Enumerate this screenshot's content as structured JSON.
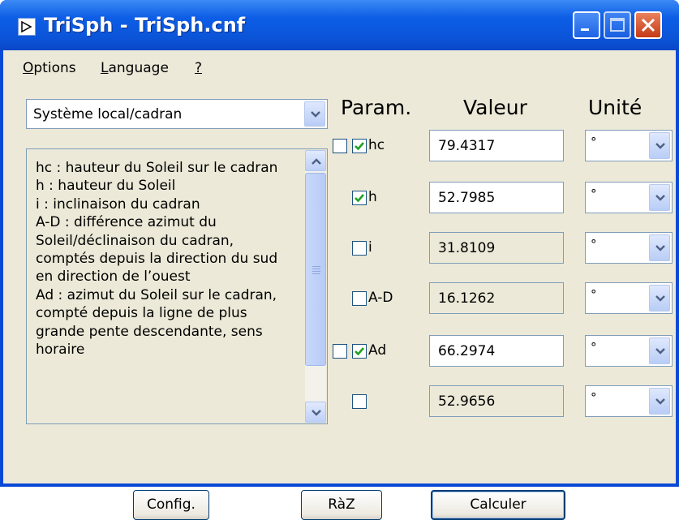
{
  "window": {
    "title": "TriSph - TriSph.cnf",
    "accent_color": "#0a49d6",
    "controls": [
      "minimize-icon",
      "maximize-icon",
      "close-icon"
    ]
  },
  "menu": {
    "items": [
      {
        "label": "Options",
        "accel": "O",
        "rest": "ptions"
      },
      {
        "label": "Language",
        "accel": "L",
        "rest": "anguage"
      },
      {
        "label": "?",
        "accel": "?",
        "rest": ""
      }
    ]
  },
  "system_select": {
    "value": "Système local/cadran"
  },
  "description": "hc : hauteur du Soleil sur le cadran\nh : hauteur du Soleil\ni : inclinaison du cadran\nA-D : différence azimut du Soleil/déclinaison du cadran, comptés depuis la direction du sud en direction de l’ouest\nAd : azimut du Soleil sur le cadran, compté depuis la ligne de plus grande pente descendante, sens horaire",
  "headers": {
    "param": "Param.",
    "value": "Valeur",
    "unit": "Unité"
  },
  "params": [
    {
      "label": "hc",
      "checked": true,
      "extra_box": true,
      "value": "79.4317",
      "editable": true,
      "unit": "°"
    },
    {
      "label": "h",
      "checked": true,
      "extra_box": false,
      "value": "52.7985",
      "editable": true,
      "unit": "°"
    },
    {
      "label": "i",
      "checked": false,
      "extra_box": false,
      "value": "31.8109",
      "editable": false,
      "unit": "°"
    },
    {
      "label": "A-D",
      "checked": false,
      "extra_box": false,
      "value": "16.1262",
      "editable": false,
      "unit": "°"
    },
    {
      "label": "Ad",
      "checked": true,
      "extra_box": true,
      "value": "66.2974",
      "editable": true,
      "unit": "°"
    },
    {
      "label": "",
      "checked": false,
      "extra_box": false,
      "value": "52.9656",
      "editable": false,
      "unit": "°"
    }
  ],
  "buttons": {
    "config": "Config.",
    "reset": "RàZ",
    "compute": "Calculer"
  }
}
